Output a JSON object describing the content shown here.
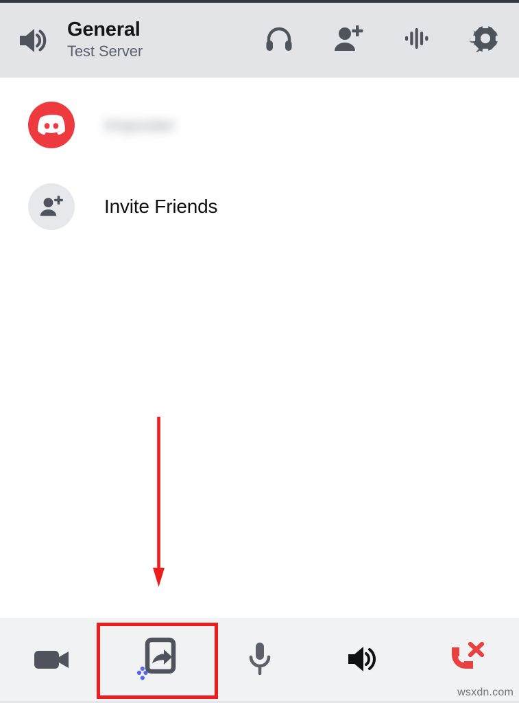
{
  "app": {
    "name": "Discord",
    "screen": "voice-channel-call"
  },
  "colors": {
    "header_bg": "#e2e4e8",
    "content_bg": "#ffffff",
    "toolbar_bg": "#f1f2f4",
    "icon_dark": "#4f545c",
    "icon_black": "#14161a",
    "discord_red": "#ec3a3f",
    "danger_red": "#e8413f",
    "annotation_red": "#ee1d1d",
    "accent_blue": "#5865f2",
    "status_strip": "#33373e"
  },
  "header": {
    "channel_name": "General",
    "server_name": "Test Server",
    "speaker_icon": "volume-speaker-icon",
    "actions": [
      {
        "icon": "headphones-icon",
        "name": "headphones-button"
      },
      {
        "icon": "add-person-icon",
        "name": "add-people-button"
      },
      {
        "icon": "soundwave-icon",
        "name": "voice-activity-button"
      },
      {
        "icon": "gear-icon",
        "name": "channel-settings-button"
      }
    ]
  },
  "member_list": {
    "rows": [
      {
        "label": "Imposter",
        "avatar": "discord-logo-avatar",
        "redacted": true,
        "name": "member-row"
      },
      {
        "label": "Invite Friends",
        "avatar": "add-person-avatar",
        "redacted": false,
        "name": "invite-friends-row"
      }
    ]
  },
  "annotation": {
    "arrow": "down-arrow-annotation",
    "highlight": "screen-share-highlight-box",
    "color": "#ee1d1d"
  },
  "call_toolbar": {
    "buttons": [
      {
        "icon": "video-camera-icon",
        "name": "toggle-video-button",
        "color": "#4f545c",
        "highlighted": false
      },
      {
        "icon": "screen-share-icon",
        "name": "screen-share-button",
        "color": "#4f545c",
        "highlighted": true
      },
      {
        "icon": "microphone-icon",
        "name": "toggle-microphone-button",
        "color": "#5b6069",
        "highlighted": false
      },
      {
        "icon": "speaker-icon",
        "name": "toggle-speaker-button",
        "color": "#101114",
        "highlighted": false
      },
      {
        "icon": "end-call-icon",
        "name": "end-call-button",
        "color": "#e8413f",
        "highlighted": false
      }
    ]
  },
  "watermark": {
    "text": "wsxdn.com"
  }
}
